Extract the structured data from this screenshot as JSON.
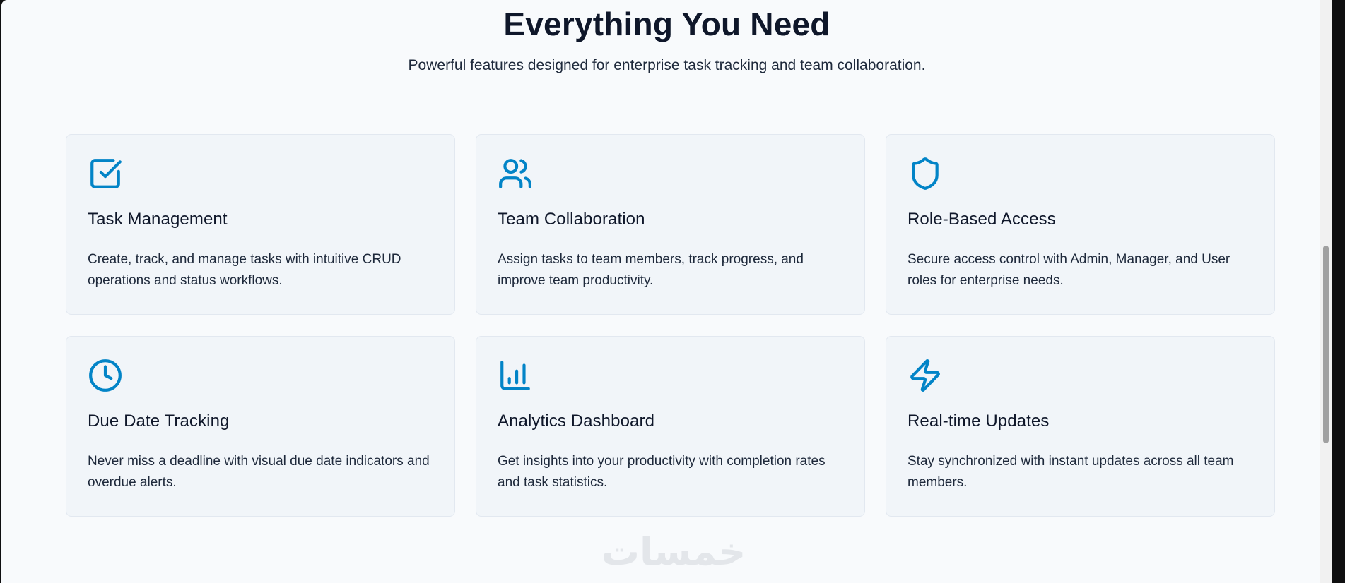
{
  "section": {
    "title": "Everything You Need",
    "subtitle": "Powerful features designed for enterprise task tracking and team collaboration."
  },
  "theme": {
    "accent": "#0284c7",
    "background": "#f8fafc",
    "card_background": "#f1f5f9",
    "card_border": "#e2e8f0",
    "heading_color": "#0f172a",
    "text_color": "#1e293b"
  },
  "features": [
    {
      "icon": "check-square-icon",
      "title": "Task Management",
      "description": "Create, track, and manage tasks with intuitive CRUD operations and status workflows."
    },
    {
      "icon": "users-icon",
      "title": "Team Collaboration",
      "description": "Assign tasks to team members, track progress, and improve team productivity."
    },
    {
      "icon": "shield-icon",
      "title": "Role-Based Access",
      "description": "Secure access control with Admin, Manager, and User roles for enterprise needs."
    },
    {
      "icon": "clock-icon",
      "title": "Due Date Tracking",
      "description": "Never miss a deadline with visual due date indicators and overdue alerts."
    },
    {
      "icon": "bar-chart-icon",
      "title": "Analytics Dashboard",
      "description": "Get insights into your productivity with completion rates and task statistics."
    },
    {
      "icon": "lightning-icon",
      "title": "Real-time Updates",
      "description": "Stay synchronized with instant updates across all team members."
    }
  ],
  "watermark": {
    "text": "خمسات"
  }
}
